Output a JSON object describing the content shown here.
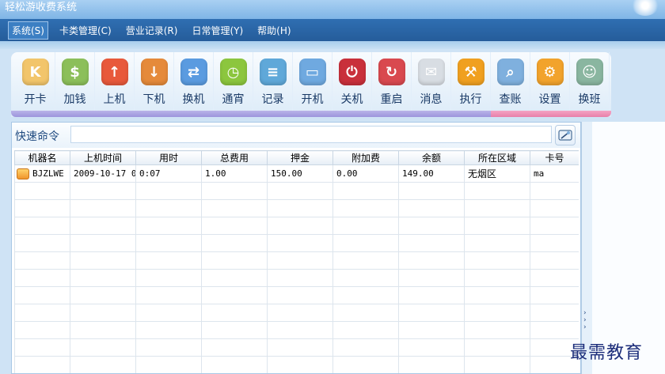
{
  "window": {
    "title": "轻松游收费系统"
  },
  "menu": {
    "items": [
      {
        "label": "系统(S)",
        "active": true
      },
      {
        "label": "卡类管理(C)"
      },
      {
        "label": "营业记录(R)"
      },
      {
        "label": "日常管理(Y)"
      },
      {
        "label": "帮助(H)"
      }
    ]
  },
  "toolbar": {
    "buttons": [
      {
        "label": "开卡",
        "icon": "card-k-icon",
        "glyph": "K",
        "color": "#f2c56b"
      },
      {
        "label": "加钱",
        "icon": "money-stack-icon",
        "glyph": "$",
        "color": "#8cbf5a"
      },
      {
        "label": "上机",
        "icon": "logon-icon",
        "glyph": "↑",
        "color": "#e8593b"
      },
      {
        "label": "下机",
        "icon": "logoff-icon",
        "glyph": "↓",
        "color": "#e58a3a"
      },
      {
        "label": "换机",
        "icon": "swap-machine-icon",
        "glyph": "⇄",
        "color": "#5a9be0"
      },
      {
        "label": "通宵",
        "icon": "overnight-clock-icon",
        "glyph": "◷",
        "color": "#8cc63e"
      },
      {
        "label": "记录",
        "icon": "records-icon",
        "glyph": "≡",
        "color": "#5fa8d9"
      },
      {
        "label": "开机",
        "icon": "power-on-icon",
        "glyph": "▭",
        "color": "#6fa9e0"
      },
      {
        "label": "关机",
        "icon": "power-off-icon",
        "glyph": "⏻",
        "color": "#c9303b"
      },
      {
        "label": "重启",
        "icon": "restart-icon",
        "glyph": "↻",
        "color": "#d9494f"
      },
      {
        "label": "消息",
        "icon": "message-envelope-icon",
        "glyph": "✉",
        "color": "#d8dde3"
      },
      {
        "label": "执行",
        "icon": "execute-hammer-icon",
        "glyph": "⚒",
        "color": "#f0a020"
      },
      {
        "label": "查账",
        "icon": "audit-magnifier-icon",
        "glyph": "⌕",
        "color": "#7fb0de"
      },
      {
        "label": "设置",
        "icon": "settings-gear-icon",
        "glyph": "⚙",
        "color": "#f2a32c"
      },
      {
        "label": "换班",
        "icon": "shift-change-users-icon",
        "glyph": "☺",
        "color": "#8ab6a0"
      }
    ]
  },
  "command": {
    "label": "快速命令",
    "value": "",
    "button_icon": "command-run-icon"
  },
  "grid": {
    "columns": [
      "机器名",
      "上机时间",
      "用时",
      "总费用",
      "押金",
      "附加费",
      "余额",
      "所在区域",
      "卡号"
    ],
    "rows": [
      [
        "BJZLWE",
        "2009-10-17 0",
        "0:07",
        "1.00",
        "150.00",
        "0.00",
        "149.00",
        "无烟区",
        "ma"
      ]
    ]
  },
  "watermark": "最需教育"
}
